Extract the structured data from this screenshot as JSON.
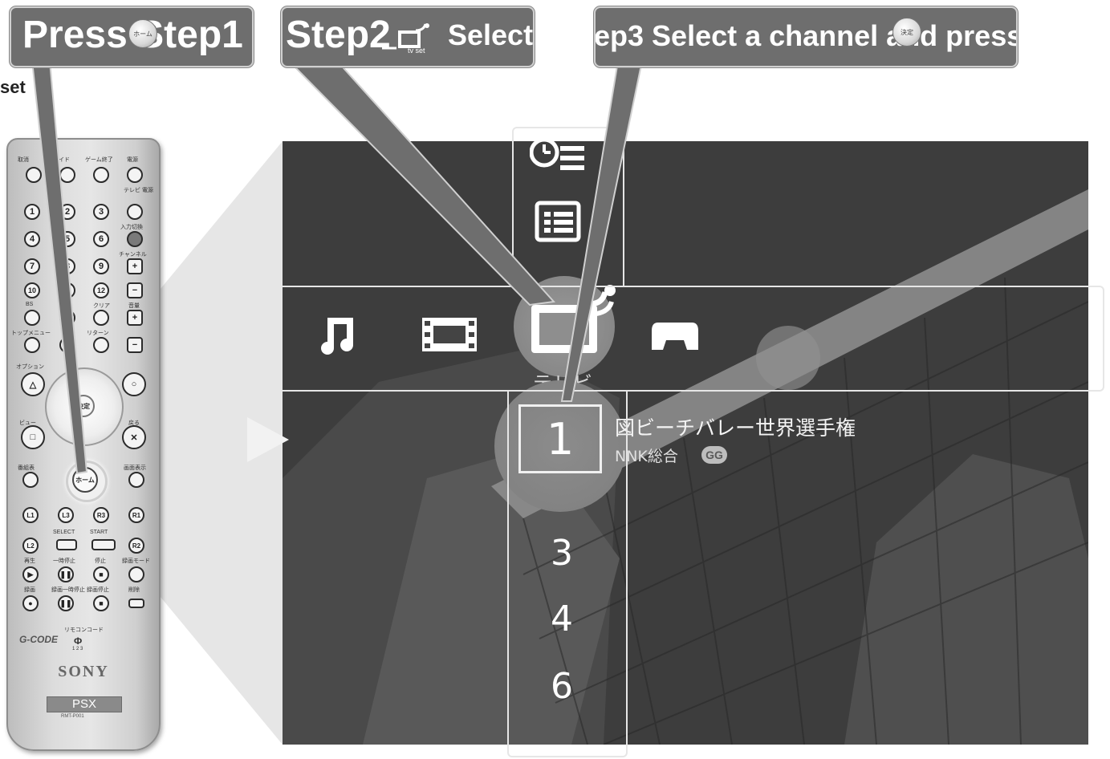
{
  "callouts": {
    "step1": "Press Step1",
    "step2_prefix": "Step2",
    "step2_action": "Select",
    "step2_icon_label": "tv set",
    "step3": "ep3 Select a channel and press",
    "home_knob": "ホーム",
    "enter_knob": "決定",
    "side_fragment": "set"
  },
  "remote": {
    "top_labels": [
      "取消",
      "ガイド",
      "ゲーム終了",
      "電源"
    ],
    "tv_power_label": "テレビ 電源",
    "input_label": "入力切換",
    "channel_label": "チャンネル",
    "volume_label": "音量",
    "digits": [
      "1",
      "2",
      "3",
      "4",
      "5",
      "6",
      "7",
      "8",
      "9",
      "10",
      "11",
      "12"
    ],
    "bs_label": "BS",
    "clear_label": "クリア",
    "return_label": "リターン",
    "top_menu_label": "トップメニュー",
    "option_label": "オプション",
    "view_label": "ビュー",
    "back_label": "戻る",
    "enter_label": "決定",
    "home_label": "ホーム",
    "guide_label": "番組表",
    "display_label": "画面表示",
    "l1": "L1",
    "l3": "L3",
    "r3": "R3",
    "r1": "R1",
    "l2": "L2",
    "r2": "R2",
    "select_label": "SELECT",
    "start_label": "START",
    "play_label": "再生",
    "pause_label": "一時停止",
    "stop_label": "停止",
    "rec_mode_label": "録画モード",
    "rec_label": "録画",
    "rec_pause_label": "録画一時停止",
    "rec_stop_label": "録画停止",
    "delete_label": "削除",
    "remote_code_label": "リモコンコード",
    "remote_code_digits": "1 2 3",
    "gcode_label": "G-CODE",
    "brand": "SONY",
    "model": "PSX",
    "model_code": "RMT-P001"
  },
  "xmb": {
    "categories": [
      "music-icon",
      "video-icon",
      "tv-icon",
      "game-icon"
    ],
    "selected_category_label": "テレビ",
    "upper_items": [
      "timer-icon",
      "program-list-icon"
    ],
    "selected_channel": "1",
    "channels": [
      "3",
      "4",
      "6"
    ],
    "program": {
      "title": "図ビーチバレー世界選手権",
      "station": "NNK総合",
      "badge": "GG"
    }
  }
}
